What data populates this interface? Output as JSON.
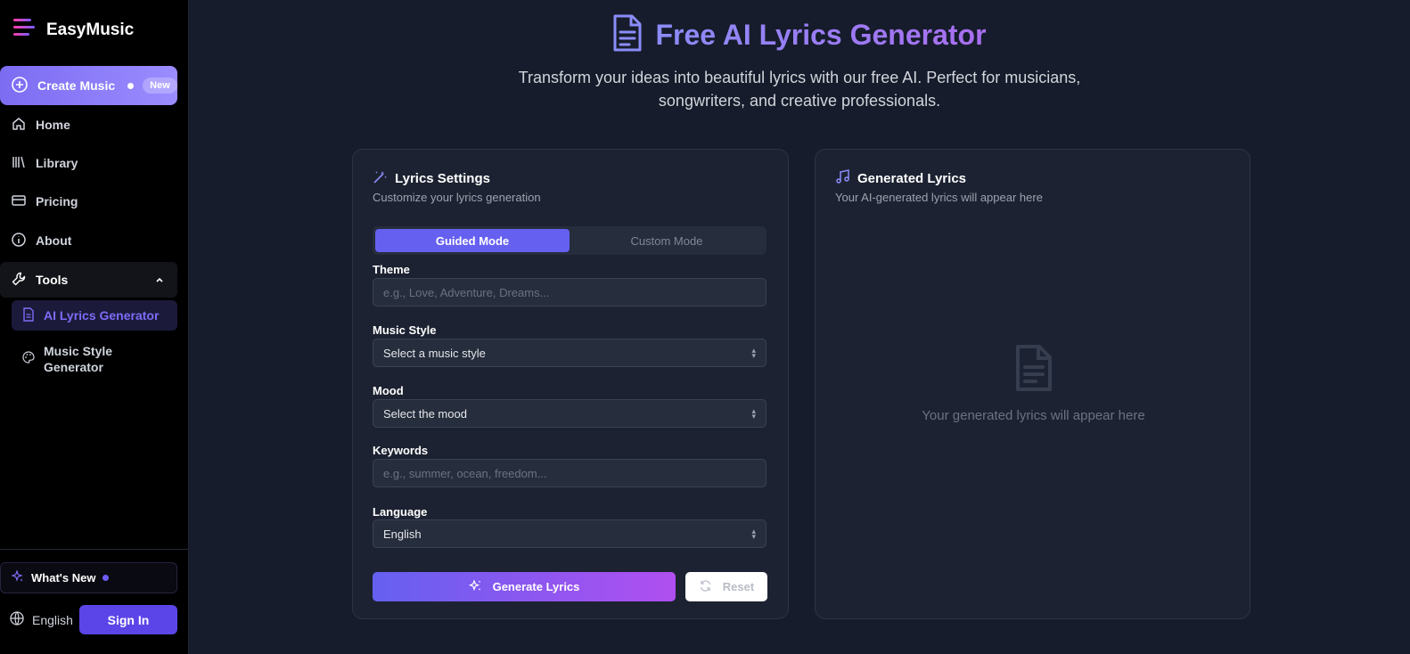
{
  "app": {
    "name": "EasyMusic"
  },
  "sidebar": {
    "create": {
      "label": "Create Music",
      "badge": "New"
    },
    "items": [
      {
        "label": "Home"
      },
      {
        "label": "Library"
      },
      {
        "label": "Pricing"
      },
      {
        "label": "About"
      }
    ],
    "tools": {
      "label": "Tools",
      "items": [
        {
          "label": "AI Lyrics Generator"
        },
        {
          "label": "Music Style Generator"
        }
      ]
    },
    "whats_new": "What's New",
    "language": "English",
    "sign_in": "Sign In"
  },
  "hero": {
    "title": "Free AI Lyrics Generator",
    "subtitle": "Transform your ideas into beautiful lyrics with our free AI. Perfect for musicians, songwriters, and creative professionals."
  },
  "settings": {
    "title": "Lyrics Settings",
    "description": "Customize your lyrics generation",
    "modes": {
      "guided": "Guided Mode",
      "custom": "Custom Mode"
    },
    "theme": {
      "label": "Theme",
      "placeholder": "e.g., Love, Adventure, Dreams..."
    },
    "music_style": {
      "label": "Music Style",
      "value": "Select a music style"
    },
    "mood": {
      "label": "Mood",
      "value": "Select the mood"
    },
    "keywords": {
      "label": "Keywords",
      "placeholder": "e.g., summer, ocean, freedom..."
    },
    "language": {
      "label": "Language",
      "value": "English"
    },
    "generate": "Generate Lyrics",
    "reset": "Reset"
  },
  "output": {
    "title": "Generated Lyrics",
    "description": "Your AI-generated lyrics will appear here",
    "empty": "Your generated lyrics will appear here"
  },
  "colors": {
    "accent": "#6560f0",
    "accent2": "#b04ff0",
    "brand": "#7b6cf6"
  }
}
